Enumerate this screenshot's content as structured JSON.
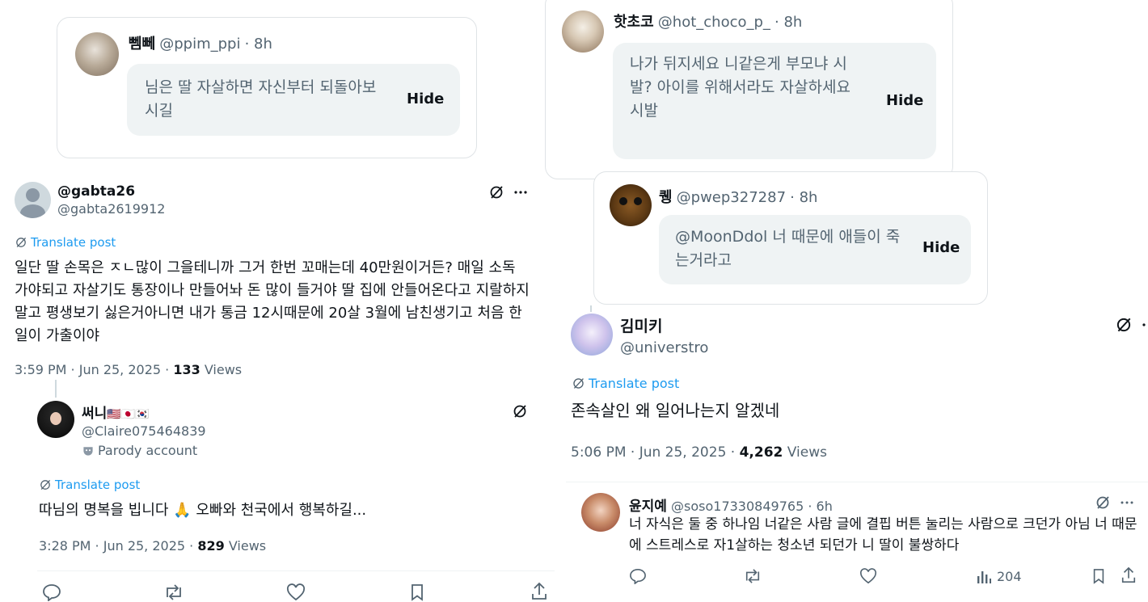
{
  "reply1": {
    "name": "뻼뻬",
    "handle": "@ppim_ppi",
    "time": "· 8h",
    "text": "님은 딸 자살하면 자신부터 되돌아보시길",
    "hide": "Hide"
  },
  "reply2": {
    "name": "핫초코",
    "handle": "@hot_choco_p_",
    "time": "· 8h",
    "text": "나가 뒤지세요 니같은게 부모냐 시발? 아이를 위해서라도 자살하세요 시발",
    "hide": "Hide"
  },
  "reply3": {
    "name": "퀭",
    "handle": "@pwep327287",
    "time": "· 8h",
    "text": "@MoonDdol 너 때문에 애들이 죽는거라고",
    "hide": "Hide"
  },
  "post1": {
    "name": "@gabta26",
    "handle": "@gabta2619912",
    "translate": "Translate post",
    "text": "일단 딸 손목은 ㅈㄴ많이 그을테니까 그거 한번 꼬매는데 40만원이거든? 매일 소독 가야되고 자살기도 통장이나 만들어놔 돈 많이 들거야 딸 집에 안들어온다고 지랄하지말고 평생보기 싫은거아니면 내가 통금 12시때문에 20살 3월에 남친생기고 처음 한 일이 가출이야",
    "date": "3:59 PM · Jun 25, 2025 · ",
    "views_count": "133",
    "views_label": " Views"
  },
  "post2": {
    "name": "써니",
    "flags": "🇺🇸🇯🇵🇰🇷",
    "handle": "@Claire075464839",
    "parody": "Parody account",
    "translate": "Translate post",
    "text": "따님의 명복을 빕니다 🙏 오빠와 천국에서 행복하길...",
    "date": "3:28 PM · Jun 25, 2025 · ",
    "views_count": "829",
    "views_label": " Views"
  },
  "post3": {
    "name": "김미키",
    "handle": "@universtro",
    "translate": "Translate post",
    "text": "존속살인 왜 일어나는지 알겠네",
    "date": "5:06 PM · Jun 25, 2025 · ",
    "views_count": "4,262",
    "views_label": " Views"
  },
  "post4": {
    "name": "윤지예",
    "handle": "@soso17330849765",
    "time": "· 6h",
    "text": "너 자식은 둘 중 하나임 너같은 사람 글에 결핍 버튼 눌리는 사람으로 크던가 아님 너 때문에 스트레스로 자1살하는 청소년 되던가 니 딸이 불쌍하다",
    "views": "204"
  },
  "colors": {
    "link": "#1d9bf0",
    "secondary": "#536471",
    "bubble": "#eff3f4",
    "text": "#0f1419"
  }
}
